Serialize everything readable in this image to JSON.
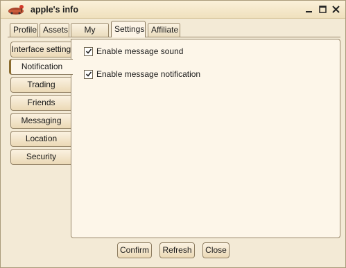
{
  "window": {
    "title": "apple's info"
  },
  "tabs": [
    {
      "label": "Profile",
      "active": false
    },
    {
      "label": "Assets",
      "active": false
    },
    {
      "label": "My family",
      "active": false
    },
    {
      "label": "Settings",
      "active": true
    },
    {
      "label": "Affiliate",
      "active": false
    }
  ],
  "side_menu": [
    {
      "label": "Interface setting",
      "active": false
    },
    {
      "label": "Notification",
      "active": true
    },
    {
      "label": "Trading",
      "active": false
    },
    {
      "label": "Friends",
      "active": false
    },
    {
      "label": "Messaging",
      "active": false
    },
    {
      "label": "Location",
      "active": false
    },
    {
      "label": "Security",
      "active": false
    }
  ],
  "options": [
    {
      "label": "Enable message sound",
      "checked": true
    },
    {
      "label": "Enable message notification",
      "checked": true
    }
  ],
  "buttons": {
    "confirm": "Confirm",
    "refresh": "Refresh",
    "close": "Close"
  },
  "icons": {
    "window_controls": [
      "minimize-icon",
      "maximize-icon",
      "close-icon"
    ]
  }
}
